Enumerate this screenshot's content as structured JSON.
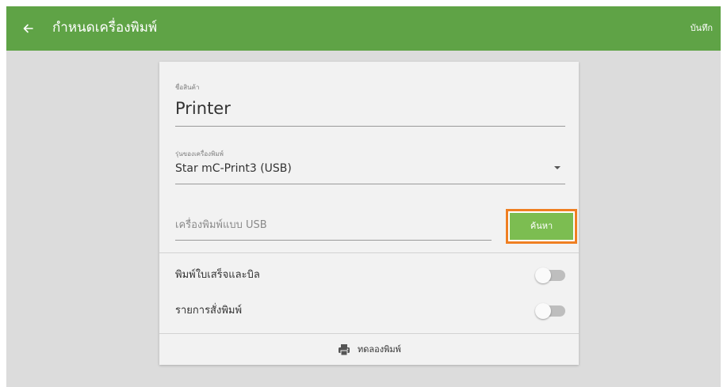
{
  "header": {
    "back_icon": "arrow-left-icon",
    "title": "กำหนดเครื่องพิมพ์",
    "save_label": "บันทึก",
    "bar_color": "#5fa346"
  },
  "form": {
    "product_name": {
      "label": "ชื่อสินค้า",
      "value": "Printer"
    },
    "printer_model": {
      "label": "รุ่นของเครื่องพิมพ์",
      "value": "Star mC-Print3 (USB)",
      "dropdown_icon": "caret-down-icon"
    },
    "usb_printer": {
      "placeholder": "เครื่องพิมพ์แบบ USB",
      "value": ""
    },
    "search_button": {
      "label": "ค้นหา",
      "color": "#7cbd51",
      "highlight_color": "#ef7f22"
    }
  },
  "toggles": [
    {
      "label": "พิมพ์ใบเสร็จและบิล",
      "on": false
    },
    {
      "label": "รายการสั่งพิมพ์",
      "on": false
    }
  ],
  "test_print": {
    "icon": "printer-icon",
    "label": "ทดลองพิมพ์"
  }
}
